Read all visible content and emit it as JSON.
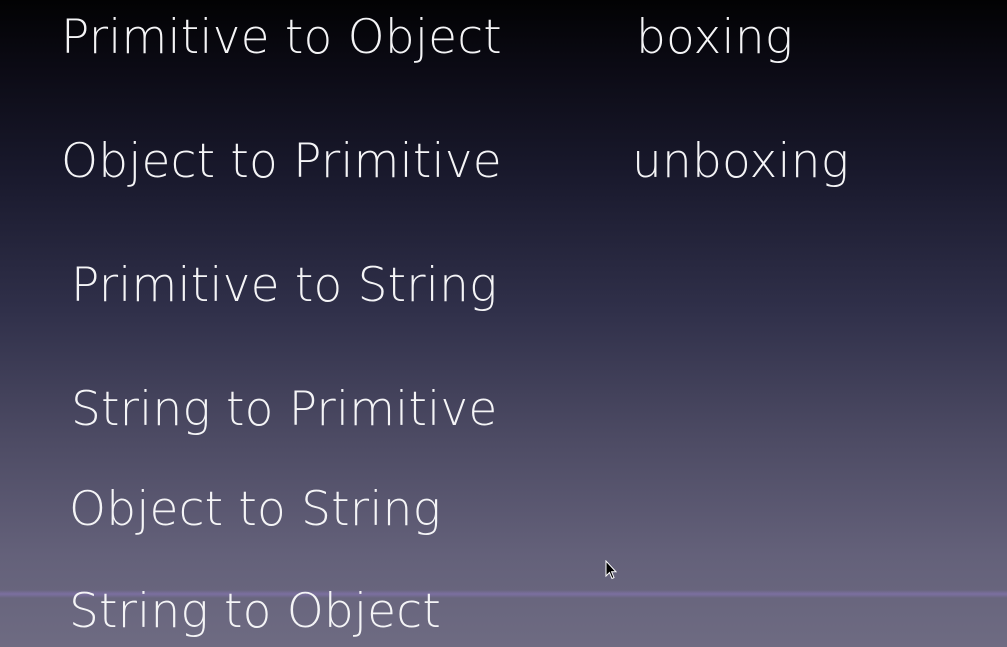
{
  "slide": {
    "rows": [
      {
        "left": "Primitive to Object",
        "right": "boxing"
      },
      {
        "left": "Object to Primitive",
        "right": "unboxing"
      },
      {
        "left": "Primitive to String"
      },
      {
        "left": "String to Primitive"
      },
      {
        "left": "Object to String"
      },
      {
        "left": "String to Object"
      }
    ]
  },
  "cursor": {
    "icon": "mouse-pointer-icon"
  }
}
